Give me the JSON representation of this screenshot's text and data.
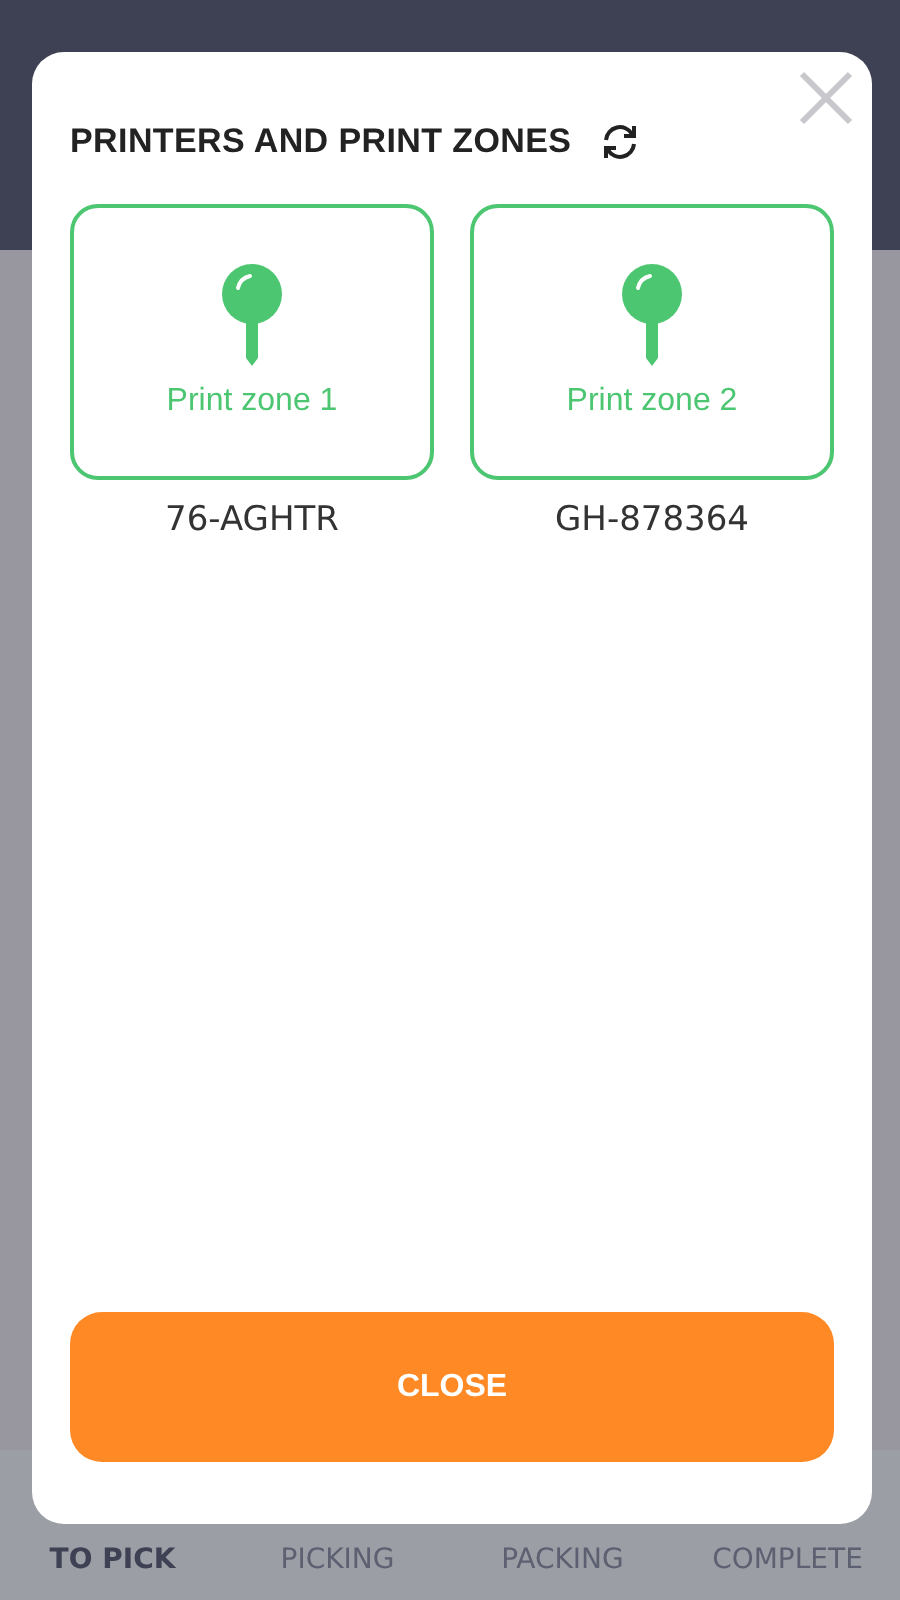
{
  "dialog": {
    "title": "PRINTERS AND PRINT ZONES",
    "zones": [
      {
        "label": "Print zone 1",
        "printer": "76-AGHTR"
      },
      {
        "label": "Print zone 2",
        "printer": "GH-878364"
      }
    ],
    "button": "CLOSE"
  },
  "bottom_tabs": [
    {
      "label": "TO PICK",
      "selected": true
    },
    {
      "label": "PICKING",
      "selected": false
    },
    {
      "label": "PACKING",
      "selected": false
    },
    {
      "label": "COMPLETE",
      "selected": false
    }
  ]
}
